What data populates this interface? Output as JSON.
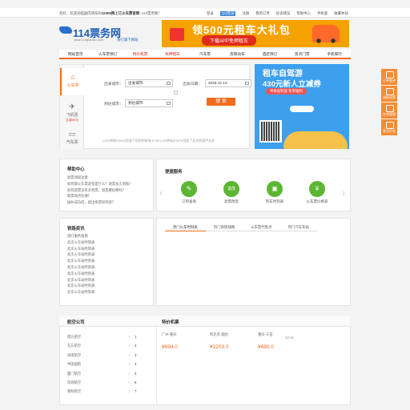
{
  "topbar": {
    "welcome_prefix": "您好，欢迎光临国内领先的",
    "welcome_bold": "12306网上订火车票官网",
    "welcome_suffix": "--114票务网！",
    "links": [
      "登录",
      "QQ登录",
      "注册",
      "我的订单",
      "投诉建议",
      "帮助中心",
      "手机版",
      "收藏本站"
    ]
  },
  "header": {
    "logo_name": "114票务网",
    "logo_domain": "www.114piaowu.com",
    "logo_slogan": "铁行旗下网站",
    "banner_title": "领500元租车大礼包",
    "banner_button": "下载APP免押租车"
  },
  "nav": {
    "items": [
      "网站首页",
      "火车票预订",
      "特价机票",
      "免押租车",
      "汽车票",
      "高铁动车",
      "酒店预订",
      "景点门票",
      "手机铁行"
    ],
    "highlight": [
      "特价机票",
      "免押租车"
    ]
  },
  "search": {
    "tabs": [
      {
        "label": "火车票",
        "icon": "train-icon"
      },
      {
        "label": "飞机票",
        "sub": "立减30元",
        "icon": "plane-icon"
      },
      {
        "label": "汽车票",
        "icon": "bus-icon"
      }
    ],
    "from_label": "出发城市：",
    "from_value": "出发城市",
    "to_label": "到达城市：",
    "to_value": "到达城市",
    "date_label": "出发日期：",
    "date_value": "2025-12-13",
    "button": "搜 索",
    "recent": "[1分钟前]F0592用途了昆明到青海 K756        [1分钟前]F6676用途了北京到葫芦岛北"
  },
  "ad": {
    "line1": "租车自驾游",
    "line2": "430元新人立减券",
    "tag": "单季返利送  免单福利"
  },
  "float": [
    "订单查询",
    "退款退票",
    "在线客服",
    "意见反馈"
  ],
  "help": {
    "title": "帮助中心",
    "items": [
      "退票须知注意",
      "如何取火车票改签是什么？退票多久到账？",
      "如何退票没有买到票，退票要扣费吗？",
      "取票地点在哪？",
      "候补成功后，留出余票如何退？"
    ]
  },
  "services": {
    "title": "便捷服务",
    "items": [
      {
        "label": "订单查询",
        "icon": "order-icon",
        "glyph": "✎"
      },
      {
        "label": "退票改签",
        "icon": "refund-icon",
        "glyph": "退改"
      },
      {
        "label": "列车时刻表",
        "icon": "train-schedule-icon",
        "glyph": "▣"
      },
      {
        "label": "火车票价格表",
        "icon": "price-icon",
        "glyph": "¥"
      }
    ]
  },
  "news": {
    "title": "铁路资讯",
    "items": [
      "旅行服务指南",
      "北京火车站时刻表",
      "北京火车站时刻表",
      "北京火车站时刻表",
      "北京火车站时刻表",
      "北京火车站时刻表",
      "北京火车站时刻表",
      "北京火车站时刻表",
      "北京火车站时刻表",
      "北京火车站时刻表"
    ],
    "tabs": [
      "热门火车时刻表",
      "热门高铁线路",
      "火车票代售点",
      "热门汽车车站"
    ]
  },
  "airlines": {
    "title": "航空公司",
    "items": [
      {
        "name": "南方航空",
        "rank": "1"
      },
      {
        "name": "东方航空",
        "rank": "2"
      },
      {
        "name": "海南航空",
        "rank": "3"
      },
      {
        "name": "中国国航",
        "rank": "4"
      },
      {
        "name": "厦门航空",
        "rank": "5"
      },
      {
        "name": "深圳航空",
        "rank": "6"
      },
      {
        "name": "春秋航空",
        "rank": "7"
      }
    ]
  },
  "fares": {
    "title": "特价机票",
    "items": [
      {
        "route": "广州-重庆",
        "price": "¥694.0"
      },
      {
        "route": "阿克苏-烟台",
        "price": "¥2203.0"
      },
      {
        "route": "重庆-三亚",
        "price": "¥680.0"
      }
    ],
    "time": "12-11"
  }
}
